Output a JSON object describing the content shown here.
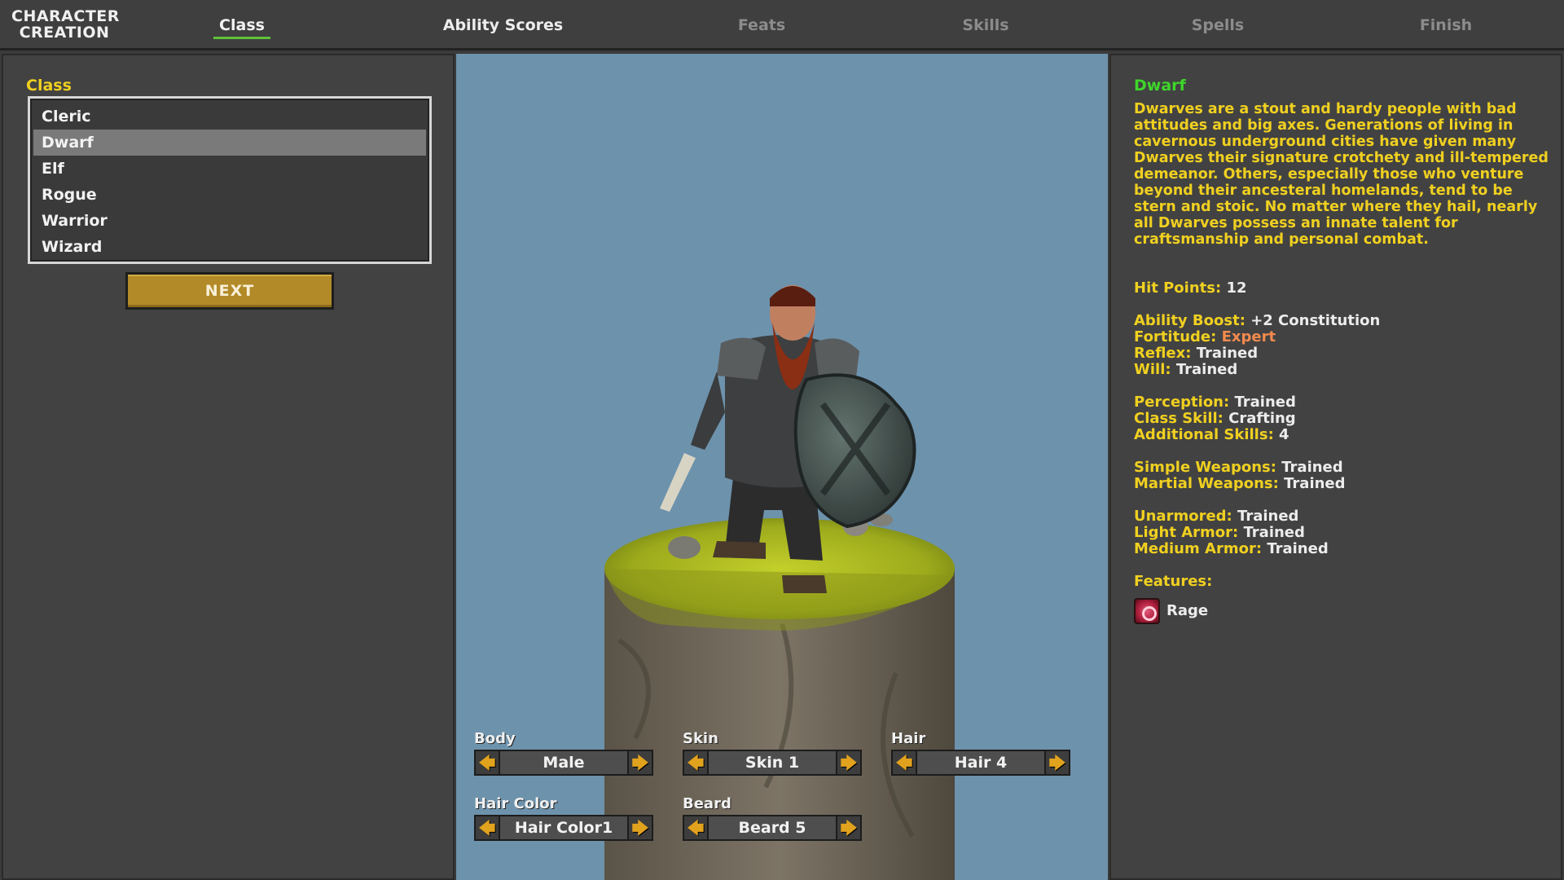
{
  "app_title": "CHARACTER CREATION",
  "tabs": [
    {
      "label": "Class",
      "state": "active"
    },
    {
      "label": "Ability Scores",
      "state": "enabled"
    },
    {
      "label": "Feats",
      "state": "disabled"
    },
    {
      "label": "Skills",
      "state": "disabled"
    },
    {
      "label": "Spells",
      "state": "disabled"
    },
    {
      "label": "Finish",
      "state": "disabled"
    }
  ],
  "class_panel": {
    "label": "Class",
    "items": [
      "Cleric",
      "Dwarf",
      "Elf",
      "Rogue",
      "Warrior",
      "Wizard"
    ],
    "selected": "Dwarf",
    "next_label": "NEXT"
  },
  "customize": {
    "body": {
      "label": "Body",
      "value": "Male"
    },
    "skin": {
      "label": "Skin",
      "value": "Skin 1"
    },
    "hair": {
      "label": "Hair",
      "value": "Hair 4"
    },
    "hair_color": {
      "label": "Hair Color",
      "value": "Hair Color1"
    },
    "beard": {
      "label": "Beard",
      "value": "Beard 5"
    }
  },
  "details": {
    "title": "Dwarf",
    "description": "Dwarves are a stout and hardy people with bad attitudes and big axes. Generations of living in cavernous underground cities have given many Dwarves their signature crotchety and ill-tempered demeanor. Others, especially those who venture beyond their ancesteral homelands, tend to be stern and stoic. No matter where they hail, nearly all Dwarves possess an innate talent for craftsmanship and personal combat.",
    "hit_points": {
      "key": "Hit Points:",
      "value": "12"
    },
    "ability_boost": {
      "key": "Ability Boost:",
      "value": "+2 Constitution"
    },
    "fortitude": {
      "key": "Fortitude:",
      "value": "Expert"
    },
    "reflex": {
      "key": "Reflex:",
      "value": "Trained"
    },
    "will": {
      "key": "Will:",
      "value": "Trained"
    },
    "perception": {
      "key": "Perception:",
      "value": "Trained"
    },
    "class_skill": {
      "key": "Class Skill:",
      "value": "Crafting"
    },
    "additional_skills": {
      "key": "Additional Skills:",
      "value": "4"
    },
    "simple_weapons": {
      "key": "Simple Weapons:",
      "value": "Trained"
    },
    "martial_weapons": {
      "key": "Martial Weapons:",
      "value": "Trained"
    },
    "unarmored": {
      "key": "Unarmored:",
      "value": "Trained"
    },
    "light_armor": {
      "key": "Light Armor:",
      "value": "Trained"
    },
    "medium_armor": {
      "key": "Medium Armor:",
      "value": "Trained"
    },
    "features_label": "Features:",
    "features": [
      {
        "name": "Rage",
        "icon": "rage-icon"
      }
    ]
  },
  "colors": {
    "accent_yellow": "#f0d020",
    "title_green": "#3ed62a",
    "expert_orange": "#f28a4e",
    "button_gold": "#b28a28",
    "arrow_orange": "#e1a21e",
    "sky_blue": "#6d92ac"
  }
}
